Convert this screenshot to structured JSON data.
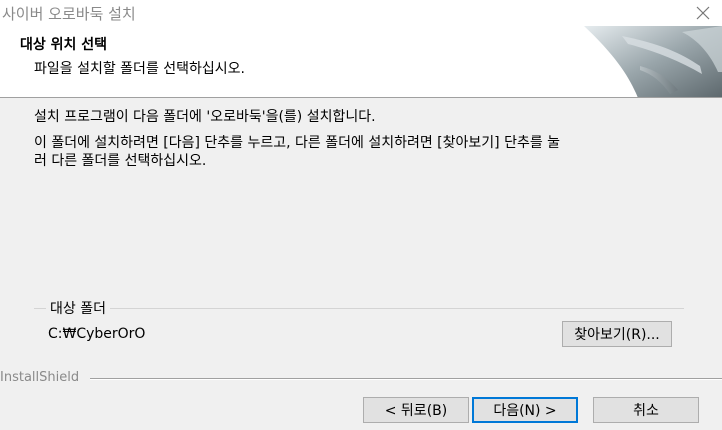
{
  "window": {
    "title": "사이버 오로바둑 설치",
    "close_icon": "close-icon"
  },
  "header": {
    "title": "대상 위치 선택",
    "subtitle": "파일을 설치할 폴더를 선택하십시오."
  },
  "body": {
    "line1": "설치 프로그램이 다음 폴더에 '오로바둑'을(를) 설치합니다.",
    "line2": "이 폴더에 설치하려면 [다음] 단추를 누르고, 다른 폴더에 설치하려면 [찾아보기] 단추를 눌",
    "line3": "러 다른 폴더를 선택하십시오."
  },
  "destination": {
    "group_label": "대상 폴더",
    "path": "C:₩CyberOrO",
    "browse_label": "찾아보기(R)..."
  },
  "footer": {
    "brand": "InstallShield",
    "back_label": "< 뒤로(B)",
    "next_label": "다음(N) >",
    "cancel_label": "취소"
  },
  "colors": {
    "background": "#f0f0f0",
    "header_background": "#ffffff",
    "default_button_border": "#0078d7"
  }
}
